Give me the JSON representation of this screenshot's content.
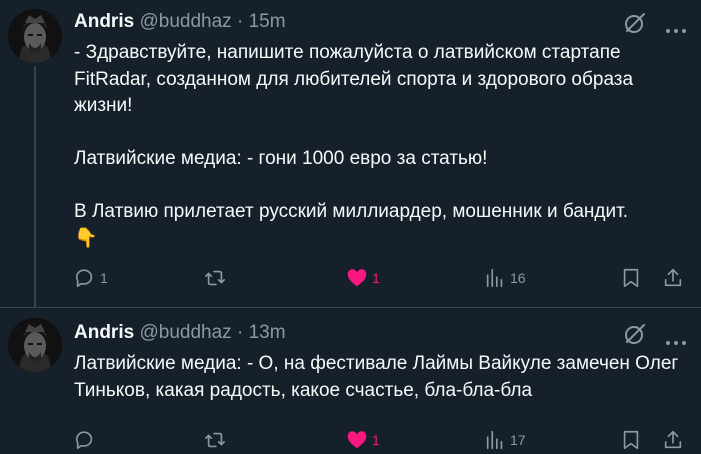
{
  "tweets": [
    {
      "author": {
        "name": "Andris",
        "handle": "@buddhaz"
      },
      "separator": "·",
      "time": "15m",
      "text": "- Здравствуйте, напишите пожалуйста о латвийском стартапе FitRadar, созданном для любителей спорта и здорового образа жизни!\n\nЛатвийские медиа: - гони 1000 евро за статью!\n\nВ Латвию прилетает русский миллиардер, мошенник и бандит.\n👇",
      "stats": {
        "replies": "1",
        "reposts": "",
        "likes": "1",
        "views": "16"
      },
      "liked": true
    },
    {
      "author": {
        "name": "Andris",
        "handle": "@buddhaz"
      },
      "separator": "·",
      "time": "13m",
      "text": "Латвийские медиа: - О, на фестивале Лаймы Вайкуле замечен Олег Тиньков, какая радость, какое счастье, бла-бла-бла",
      "stats": {
        "replies": "",
        "reposts": "",
        "likes": "1",
        "views": "17"
      },
      "liked": true
    }
  ],
  "colors": {
    "background": "#15202b",
    "text": "#f7f9f9",
    "secondary": "#8b98a5",
    "like": "#f91880",
    "divider": "#38444d"
  },
  "icons": [
    "avatar",
    "grok-icon",
    "more-icon",
    "reply-icon",
    "repost-icon",
    "heart-icon",
    "views-icon",
    "bookmark-icon",
    "share-icon"
  ]
}
